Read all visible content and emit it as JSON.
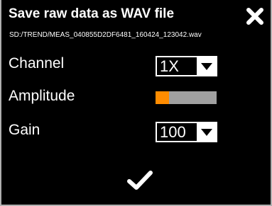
{
  "dialog": {
    "title": "Save raw data as WAV file",
    "file_path": "SD:/TREND/MEAS_040855D2DF6481_160424_123042.wav",
    "close_icon": "close-icon",
    "confirm_icon": "checkmark-icon"
  },
  "fields": {
    "channel": {
      "label": "Channel",
      "value": "1X",
      "icon": "dropdown-arrow-icon"
    },
    "amplitude": {
      "label": "Amplitude",
      "level": 0.22,
      "fill_color": "#ff8c00",
      "track_color": "#a0a0a0"
    },
    "gain": {
      "label": "Gain",
      "value": "100",
      "icon": "dropdown-arrow-icon"
    }
  }
}
